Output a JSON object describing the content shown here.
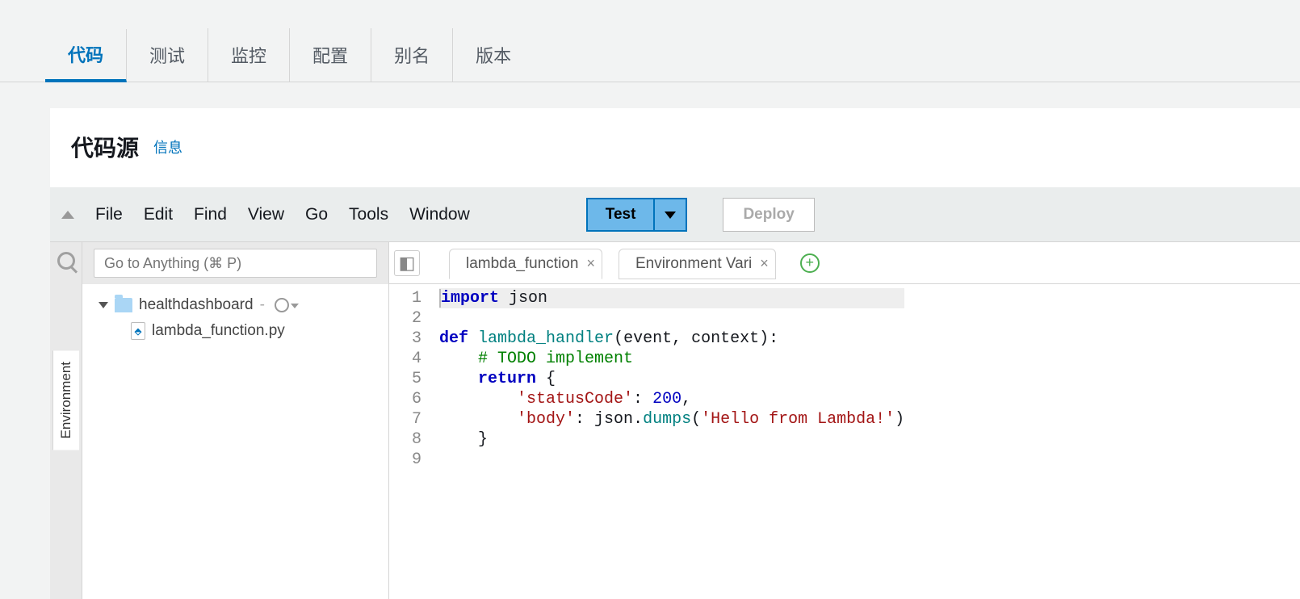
{
  "tabs": [
    "代码",
    "测试",
    "监控",
    "配置",
    "别名",
    "版本"
  ],
  "panel": {
    "title": "代码源",
    "info": "信息"
  },
  "menu": [
    "File",
    "Edit",
    "Find",
    "View",
    "Go",
    "Tools",
    "Window"
  ],
  "buttons": {
    "test": "Test",
    "deploy": "Deploy"
  },
  "search": {
    "placeholder": "Go to Anything (⌘ P)"
  },
  "side": {
    "environment": "Environment"
  },
  "tree": {
    "folder": "healthdashboard",
    "file": "lambda_function.py"
  },
  "etabs": [
    {
      "label": "lambda_function",
      "closable": true
    },
    {
      "label": "Environment Vari",
      "closable": true
    }
  ],
  "history_glyph": "◧",
  "code": {
    "l1": "import json",
    "l3": "def lambda_handler(event, context):",
    "l4": "    # TODO implement",
    "l5": "    return {",
    "l6": "        'statusCode': 200,",
    "l7": "        'body': json.dumps('Hello from Lambda!')",
    "l8": "    }"
  },
  "tokens": {
    "import": "import",
    "json": "json",
    "def": "def",
    "fname": "lambda_handler",
    "args": "(event, context):",
    "comment": "# TODO implement",
    "ret": "return",
    "brace_o": "{",
    "sc": "'statusCode'",
    "colon1": ": ",
    "num": "200",
    "comma": ",",
    "body": "'body'",
    "colon2": ": ",
    "jsonv": "json",
    "dot": ".",
    "dumps": "dumps",
    "paren_o": "(",
    "hello": "'Hello from Lambda!'",
    "paren_c": ")",
    "brace_c": "}"
  }
}
